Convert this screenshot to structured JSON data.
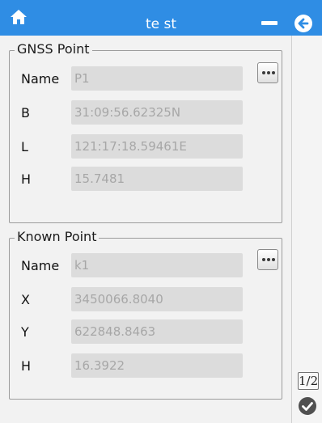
{
  "header": {
    "title": "te st",
    "icons": {
      "home": "home-icon",
      "minimize": "minimize-icon",
      "back": "back-arrow-icon"
    }
  },
  "gnss_point": {
    "legend": "GNSS Point",
    "more_icon": "more-dots-icon",
    "fields": [
      {
        "label": "Name",
        "value": "P1"
      },
      {
        "label": "B",
        "value": "31:09:56.62325N"
      },
      {
        "label": "L",
        "value": "121:17:18.59461E"
      },
      {
        "label": "H",
        "value": "15.7481"
      }
    ]
  },
  "known_point": {
    "legend": "Known Point",
    "more_icon": "more-dots-icon",
    "fields": [
      {
        "label": "Name",
        "value": "k1"
      },
      {
        "label": "X",
        "value": "3450066.8040"
      },
      {
        "label": "Y",
        "value": "622848.8463"
      },
      {
        "label": "H",
        "value": "16.3922"
      }
    ]
  },
  "pager": {
    "indicator": "1/2"
  },
  "footer": {
    "ok_icon": "check-circle-icon"
  },
  "colors": {
    "titlebar": "#2f8de4",
    "background": "#f2f2f2",
    "field_background": "#dcdcdc",
    "field_text": "#a7a7a7",
    "button_icon": "#505050"
  }
}
